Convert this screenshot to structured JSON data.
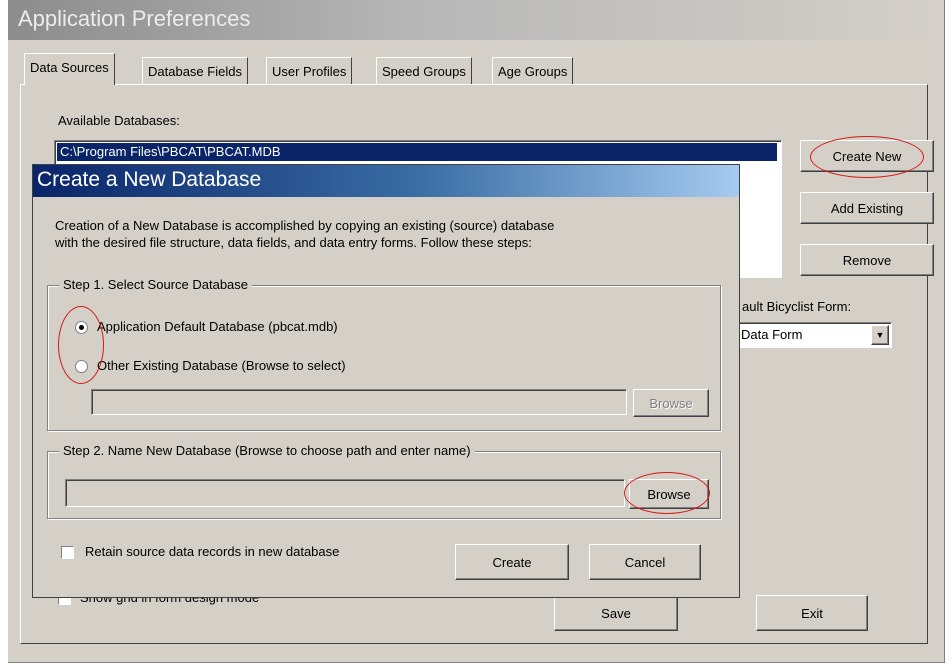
{
  "window": {
    "title": "Application Preferences"
  },
  "tabs": [
    {
      "label": "Data Sources"
    },
    {
      "label": "Database Fields"
    },
    {
      "label": "User Profiles"
    },
    {
      "label": "Speed Groups"
    },
    {
      "label": "Age Groups"
    }
  ],
  "data_sources": {
    "available_label": "Available Databases:",
    "databases": [
      "C:\\Program Files\\PBCAT\\PBCAT.MDB"
    ],
    "create_new_label": "Create New",
    "add_existing_label": "Add Existing",
    "remove_label": "Remove",
    "default_bicyclist_form_label": "ault Bicyclist Form:",
    "default_bicyclist_form_value": "Data Form",
    "show_grid_label": "Show grid in form design mode",
    "save_label": "Save",
    "exit_label": "Exit"
  },
  "dialog": {
    "title": "Create a New Database",
    "description_line1": "Creation of a New Database is accomplished by copying an existing (source) database",
    "description_line2": "with the desired file structure, data fields, and data entry forms. Follow these steps:",
    "step1": {
      "label": "Step 1. Select Source Database",
      "option_default": "Application Default Database (pbcat.mdb)",
      "option_other": "Other Existing Database (Browse to select)",
      "path_value": "",
      "browse_label": "Browse"
    },
    "step2": {
      "label": "Step 2. Name New Database (Browse to choose path and enter name)",
      "path_value": "",
      "browse_label": "Browse"
    },
    "retain_label": "Retain source data records in new database",
    "create_label": "Create",
    "cancel_label": "Cancel"
  },
  "colors": {
    "annotation": "#d81818",
    "selection": "#0a246a",
    "dialog_title_start": "#0a246a",
    "dialog_title_end": "#a6caf0"
  },
  "icons": [
    "dropdown-arrow-icon",
    "radio-selected-icon",
    "radio-unselected-icon",
    "checkbox-icon"
  ]
}
